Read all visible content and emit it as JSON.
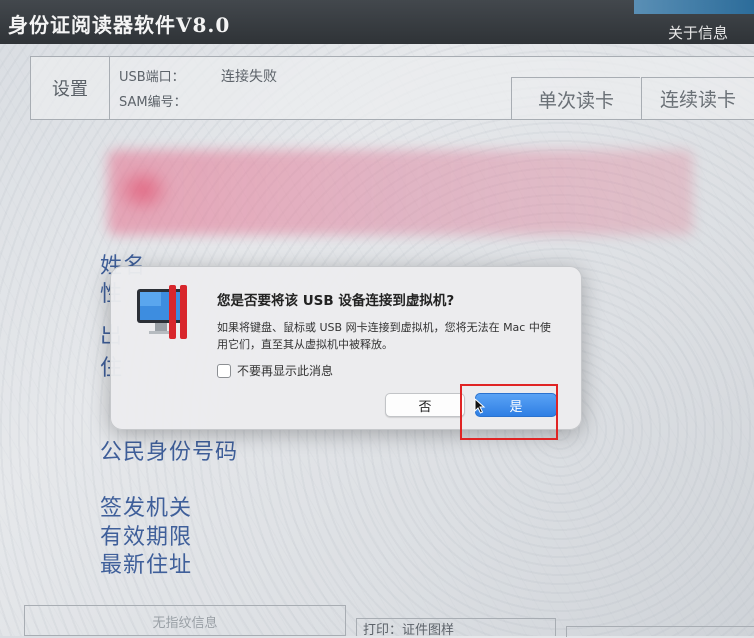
{
  "window": {
    "title": "身份证阅读器软件V8.0",
    "about_label": "关于信息"
  },
  "toolbar": {
    "settings_label": "设置",
    "usb_port_label": "USB端口：",
    "usb_port_status": "连接失败",
    "sam_label": "SAM编号：",
    "single_read_label": "单次读卡",
    "continuous_read_label": "连续读卡"
  },
  "fields": {
    "name_label": "姓名",
    "name_frag_2": "性",
    "name_frag_3": "出",
    "name_frag_4": "住",
    "citizen_id_label": "公民身份号码",
    "issuing_authority_label": "签发机关",
    "validity_label": "有效期限",
    "latest_address_label": "最新住址"
  },
  "dialog": {
    "title": "您是否要将该 USB 设备连接到虚拟机?",
    "body": "如果将键盘、鼠标或 USB 网卡连接到虚拟机，您将无法在 Mac 中使用它们，直至其从虚拟机中被释放。",
    "checkbox_label": "不要再显示此消息",
    "checkbox_checked": false,
    "no_label": "否",
    "yes_label": "是",
    "yes_color": "#2f7fe4"
  },
  "status_bar": {
    "fingerprint_label": "无指纹信息",
    "print_label": "打印：证件图样"
  },
  "colors": {
    "titlebar": "#2f3337",
    "field_text": "#3f5f9a",
    "highlight": "#e02424"
  }
}
